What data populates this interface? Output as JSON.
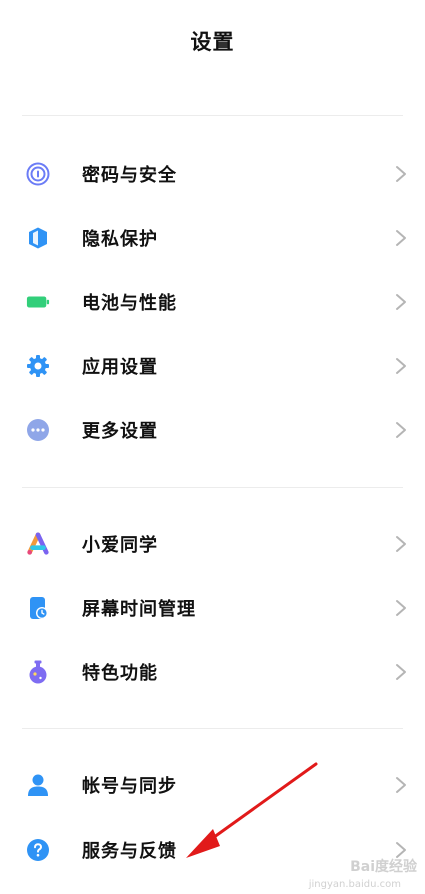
{
  "header": {
    "title": "设置"
  },
  "groups": [
    {
      "items": [
        {
          "label": "密码与安全",
          "icon": "fingerprint-icon",
          "color": "#6b7cf6"
        },
        {
          "label": "隐私保护",
          "icon": "privacy-shield-icon",
          "color": "#2f93f5"
        },
        {
          "label": "电池与性能",
          "icon": "battery-icon",
          "color": "#32cf7a"
        },
        {
          "label": "应用设置",
          "icon": "gear-icon",
          "color": "#2f93f5"
        },
        {
          "label": "更多设置",
          "icon": "more-dots-icon",
          "color": "#8fa6e8"
        }
      ]
    },
    {
      "items": [
        {
          "label": "小爱同学",
          "icon": "xiaoai-assistant-icon",
          "color": "#7a63f0"
        },
        {
          "label": "屏幕时间管理",
          "icon": "screen-time-icon",
          "color": "#2f93f5"
        },
        {
          "label": "特色功能",
          "icon": "flask-icon",
          "color": "#7e6cf2"
        }
      ]
    },
    {
      "items": [
        {
          "label": "帐号与同步",
          "icon": "user-icon",
          "color": "#2f93f5"
        },
        {
          "label": "服务与反馈",
          "icon": "help-circle-icon",
          "color": "#2f93f5"
        }
      ]
    }
  ],
  "watermark": {
    "text": "Bai度经验",
    "sub": "jingyan.baidu.com"
  },
  "accent_colors": {
    "annotation_arrow": "#e11a1a",
    "chevron": "#b5b5b5"
  }
}
